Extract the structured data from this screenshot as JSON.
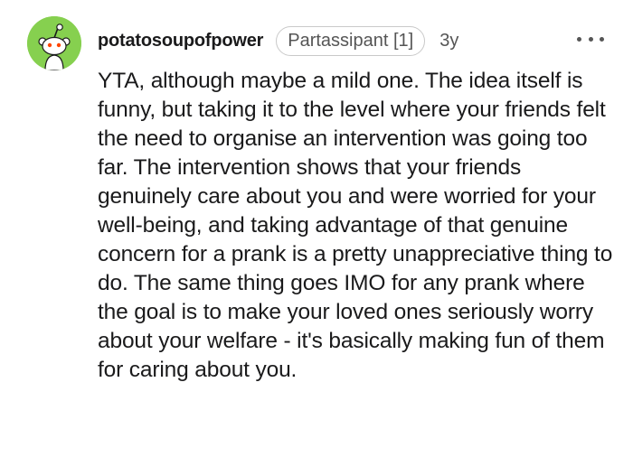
{
  "comment": {
    "username": "potatosoupofpower",
    "flair": "Partassipant [1]",
    "age": "3y",
    "body": "YTA, although maybe a mild one. The idea itself is funny, but taking it to the level where your friends felt the need to organise an intervention was going too far. The intervention shows that your friends genuinely care about you and were worried for your well-being, and taking advantage of that genuine concern for a prank is a pretty unappreciative thing to do. The same thing goes IMO for any prank where the goal is to make your loved ones seriously worry about your welfare - it's basically making fun of them for caring about you."
  },
  "avatar": {
    "icon": "snoo-avatar-icon",
    "background_color": "#86d04f"
  },
  "icons": {
    "more": "more-options-icon"
  }
}
